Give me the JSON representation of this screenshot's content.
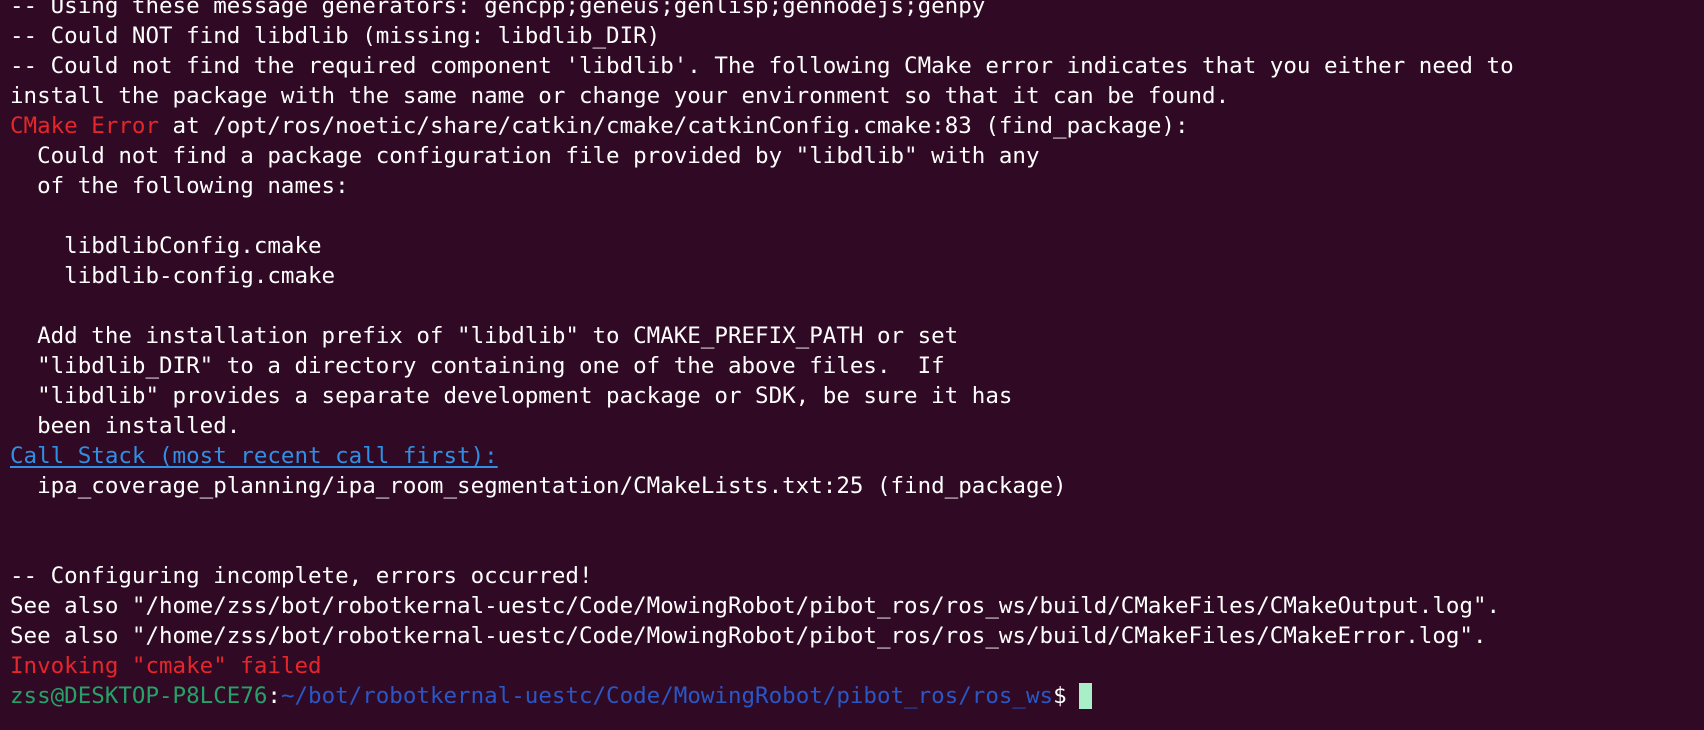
{
  "theme": {
    "background": "#300a24",
    "foreground": "#ffffff",
    "error_red": "#e5262b",
    "link_blue": "#2f8fe4",
    "prompt_green": "#26a269",
    "path_blue": "#2a56c6",
    "cursor_color": "#a8efc8"
  },
  "terminal": {
    "lines": [
      "-- Using these message generators: gencpp;geneus;genlisp;gennodejs;genpy",
      "-- Could NOT find libdlib (missing: libdlib_DIR)",
      "-- Could not find the required component 'libdlib'. The following CMake error indicates that you either need to",
      "install the package with the same name or change your environment so that it can be found.",
      "",
      "  Could not find a package configuration file provided by \"libdlib\" with any",
      "  of the following names:",
      "",
      "    libdlibConfig.cmake",
      "    libdlib-config.cmake",
      "",
      "  Add the installation prefix of \"libdlib\" to CMAKE_PREFIX_PATH or set",
      "  \"libdlib_DIR\" to a directory containing one of the above files.  If",
      "  \"libdlib\" provides a separate development package or SDK, be sure it has",
      "  been installed.",
      "",
      "  ipa_coverage_planning/ipa_room_segmentation/CMakeLists.txt:25 (find_package)",
      "",
      "",
      "-- Configuring incomplete, errors occurred!",
      "See also \"/home/zss/bot/robotkernal-uestc/Code/MowingRobot/pibot_ros/ros_ws/build/CMakeFiles/CMakeOutput.log\".",
      "See also \"/home/zss/bot/robotkernal-uestc/Code/MowingRobot/pibot_ros/ros_ws/build/CMakeFiles/CMakeError.log\"."
    ],
    "top_cut_line": "-- ... __     ..(.. __ .. _..... _.. .., .. _..... _.. ..... ......)",
    "cmake_error": {
      "label": "CMake Error",
      "rest": " at /opt/ros/noetic/share/catkin/cmake/catkinConfig.cmake:83 (find_package):"
    },
    "call_stack": "Call Stack (most recent call first):",
    "invoking_failed": "Invoking \"cmake\" failed",
    "prompt": {
      "user_host": "zss@DESKTOP-P8LCE76",
      "colon": ":",
      "path": "~/bot/robotkernal-uestc/Code/MowingRobot/pibot_ros/ros_ws",
      "dollar": "$"
    }
  }
}
